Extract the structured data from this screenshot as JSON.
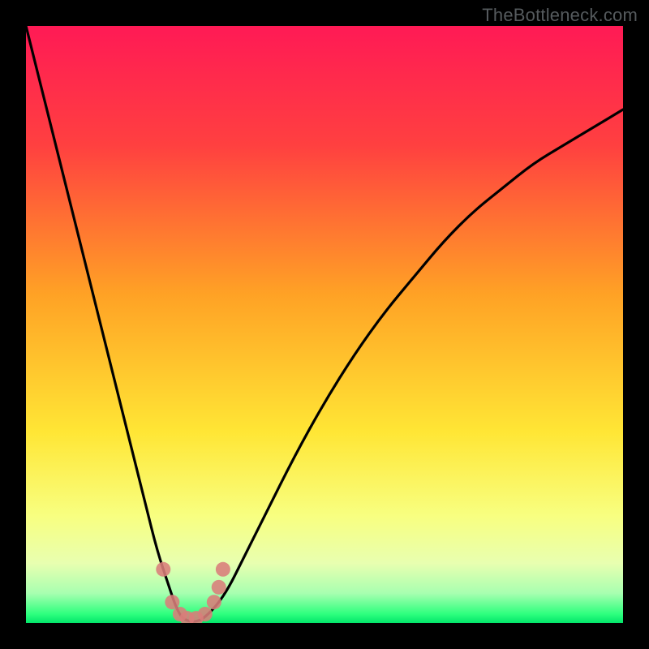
{
  "watermark": "TheBottleneck.com",
  "chart_data": {
    "type": "line",
    "title": "",
    "xlabel": "",
    "ylabel": "",
    "x": [
      0,
      5,
      10,
      15,
      20,
      22,
      24,
      25,
      26,
      27,
      28,
      29,
      30,
      32,
      34,
      36,
      40,
      45,
      50,
      55,
      60,
      65,
      70,
      75,
      80,
      85,
      90,
      95,
      100
    ],
    "y": [
      100,
      80,
      60,
      40,
      20,
      12,
      6,
      3,
      1,
      0.4,
      0.2,
      0.4,
      1,
      3,
      6,
      10,
      18,
      28,
      37,
      45,
      52,
      58,
      64,
      69,
      73,
      77,
      80,
      83,
      86
    ],
    "xlim": [
      0,
      100
    ],
    "ylim": [
      0,
      100
    ],
    "minimum_x": 27.5,
    "markers": [
      {
        "x": 23.0,
        "y": 9.0
      },
      {
        "x": 24.5,
        "y": 3.5
      },
      {
        "x": 25.8,
        "y": 1.5
      },
      {
        "x": 27.0,
        "y": 0.8
      },
      {
        "x": 28.5,
        "y": 0.8
      },
      {
        "x": 30.0,
        "y": 1.5
      },
      {
        "x": 31.5,
        "y": 3.5
      },
      {
        "x": 32.3,
        "y": 6.0
      },
      {
        "x": 33.0,
        "y": 9.0
      }
    ],
    "background": {
      "type": "vertical-gradient",
      "stops": [
        {
          "pct": 0,
          "color": "#ff1a55"
        },
        {
          "pct": 20,
          "color": "#ff4040"
        },
        {
          "pct": 45,
          "color": "#ffa225"
        },
        {
          "pct": 68,
          "color": "#ffe635"
        },
        {
          "pct": 82,
          "color": "#f8ff80"
        },
        {
          "pct": 90,
          "color": "#e8ffb0"
        },
        {
          "pct": 95,
          "color": "#a8ffb0"
        },
        {
          "pct": 98.5,
          "color": "#2eff7e"
        },
        {
          "pct": 100,
          "color": "#02e56a"
        }
      ]
    }
  }
}
